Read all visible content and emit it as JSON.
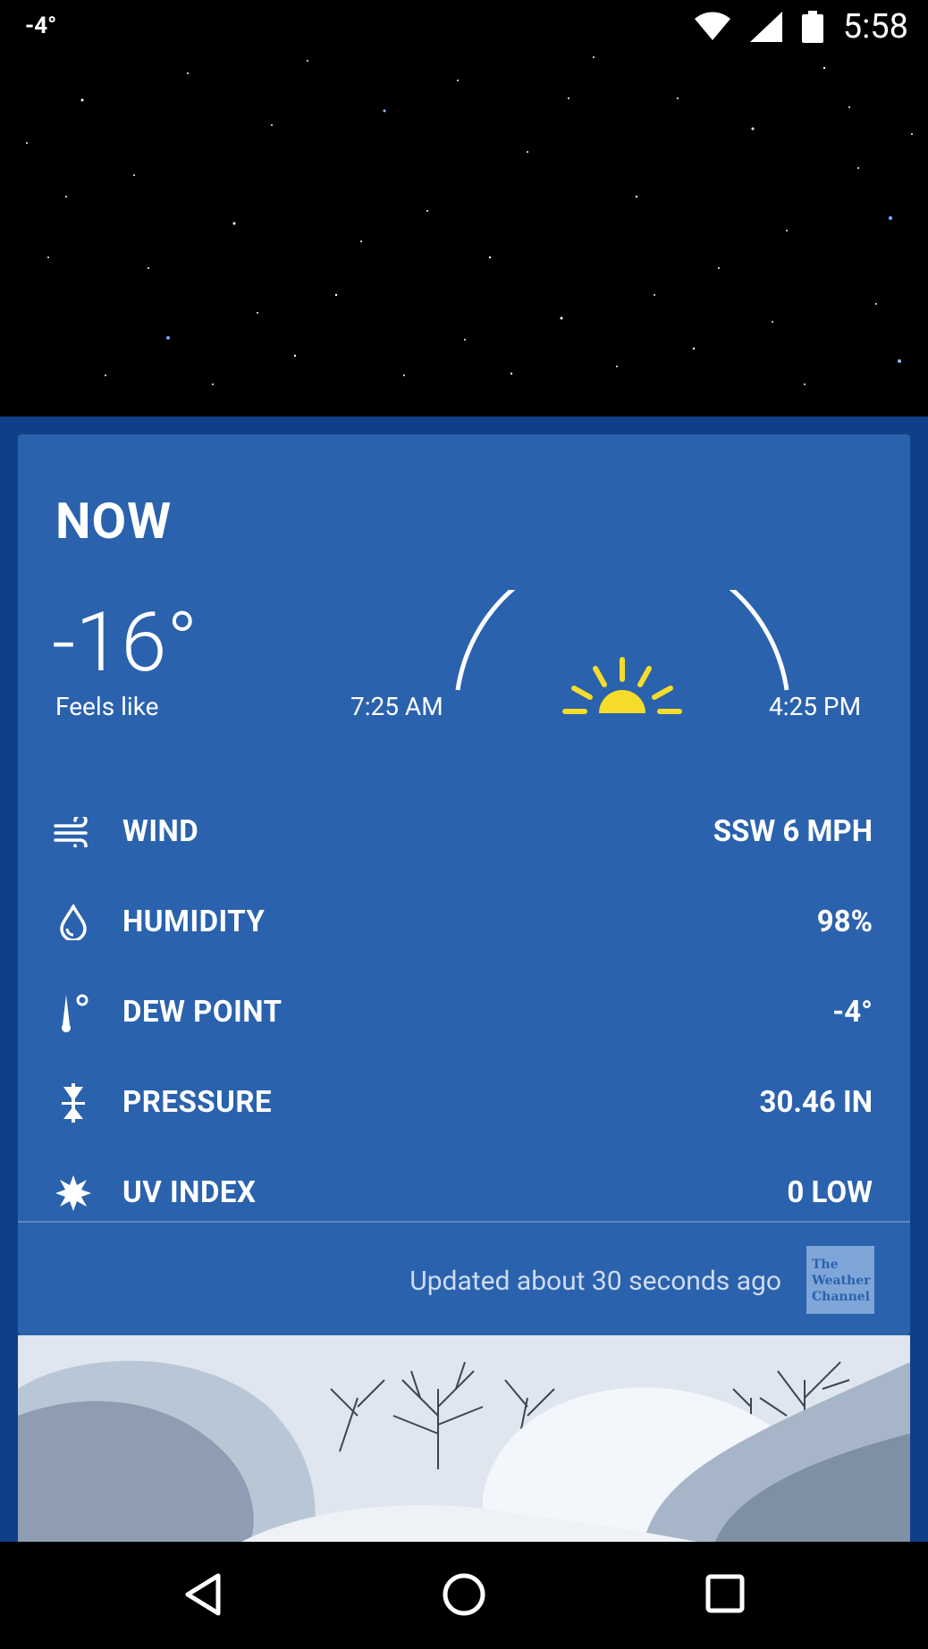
{
  "status_bar": {
    "left_temp": "-4°",
    "time": "5:58",
    "icons": [
      "wifi-icon",
      "cell-signal-icon",
      "battery-icon"
    ]
  },
  "now": {
    "title": "NOW",
    "temperature": "-16°",
    "feels_like_label": "Feels like",
    "sunrise": "7:25 AM",
    "sunset": "4:25 PM"
  },
  "conditions": [
    {
      "icon": "wind-icon",
      "label": "WIND",
      "value": "SSW 6 MPH"
    },
    {
      "icon": "humidity-drop-icon",
      "label": "HUMIDITY",
      "value": "98%"
    },
    {
      "icon": "thermometer-icon",
      "label": "DEW POINT",
      "value": "-4°"
    },
    {
      "icon": "pressure-icon",
      "label": "PRESSURE",
      "value": "30.46 IN"
    },
    {
      "icon": "uv-sun-icon",
      "label": "UV INDEX",
      "value": "0 LOW"
    }
  ],
  "footer": {
    "updated_text": "Updated about 30 seconds ago",
    "logo_text": "The Weather Channel"
  },
  "colors": {
    "card": "#2a62ad",
    "panel": "#0f3f86",
    "sun": "#f5dc2b"
  }
}
